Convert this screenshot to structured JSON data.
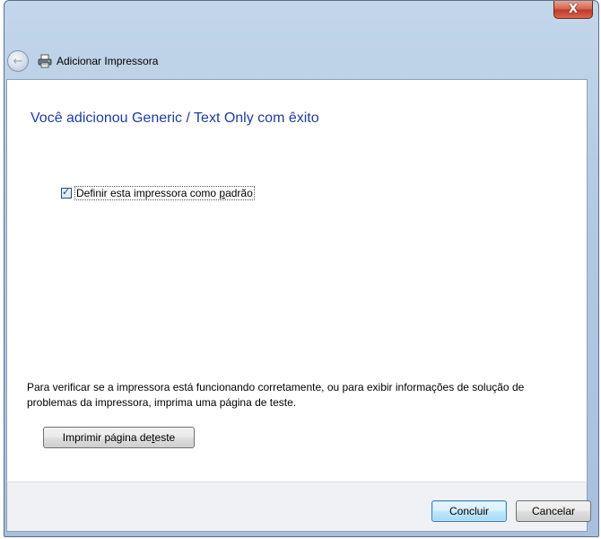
{
  "window": {
    "close_glyph": "X",
    "title": "Adicionar Impressora",
    "back_icon": "back-arrow-icon",
    "app_icon": "printer-icon"
  },
  "content": {
    "heading": "Você adicionou Generic / Text Only com êxito",
    "default_checkbox": {
      "checked": true,
      "label_prefix": "Definir esta impressora como ",
      "label_accel": "p",
      "label_suffix": "adrão"
    },
    "info_text": "Para verificar se a impressora está funcionando corretamente, ou para exibir informações de solução de problemas da impressora, imprima uma página de teste.",
    "test_button": {
      "label_prefix": "Imprimir página de ",
      "label_accel": "t",
      "label_suffix": "este"
    }
  },
  "footer": {
    "finish_label": "Concluir",
    "cancel_label": "Cancelar"
  },
  "colors": {
    "heading": "#1f3d9c",
    "close_button": "#c0392b",
    "default_button_border": "#3c7fb1"
  }
}
